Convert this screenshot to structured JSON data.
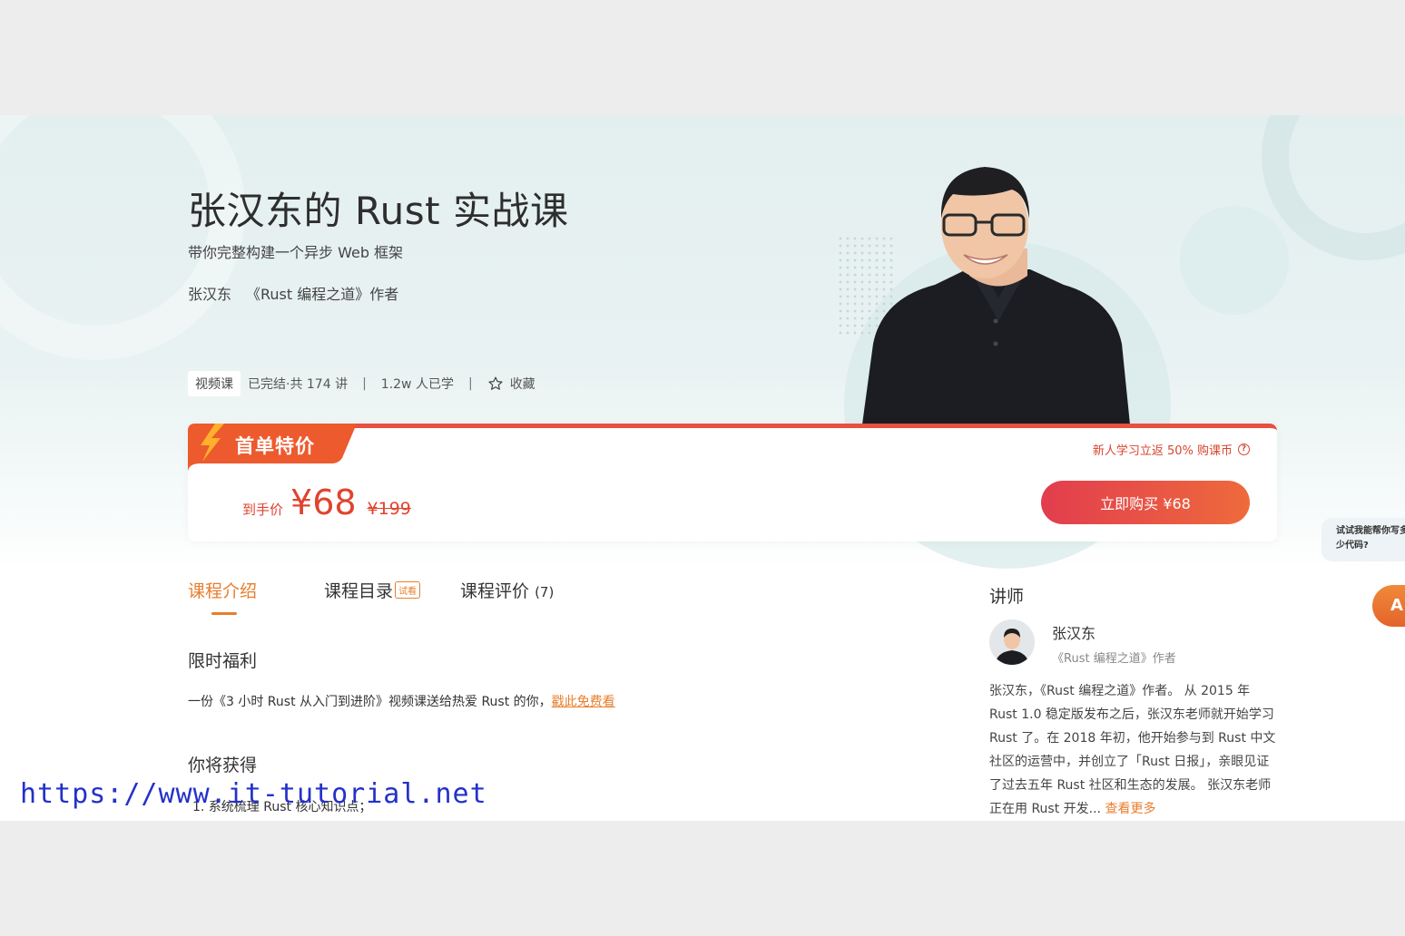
{
  "course": {
    "title": "张汉东的 Rust 实战课",
    "subtitle": "带你完整构建一个异步 Web 框架",
    "author_name": "张汉东",
    "author_title": "《Rust 编程之道》作者"
  },
  "meta": {
    "type_badge": "视频课",
    "status": "已完结·共 174 讲",
    "separator": "|",
    "learners": "1.2w 人已学",
    "favorite_label": "收藏"
  },
  "price": {
    "promo_tag": "首单特价",
    "promo_link": "新人学习立返 50% 购课币",
    "label": "到手价",
    "current": "¥68",
    "original": "¥199",
    "buy_button": "立即购买 ¥68"
  },
  "tabs": {
    "intro": "课程介绍",
    "catalog": "课程目录",
    "trial_badge": "试看",
    "review": "课程评价",
    "review_count": "(7)"
  },
  "content": {
    "benefit_title": "限时福利",
    "benefit_text": "一份《3 小时 Rust 从入门到进阶》视频课送给热爱 Rust 的你，",
    "benefit_link": "戳此免费看",
    "gain_title": "你将获得",
    "gain_item_1": "1. 系统梳理 Rust 核心知识点；"
  },
  "lecturer": {
    "heading": "讲师",
    "name": "张汉东",
    "role": "《Rust 编程之道》作者",
    "bio": "张汉东，《Rust 编程之道》作者。 从 2015 年 Rust 1.0 稳定版发布之后，张汉东老师就开始学习 Rust 了。在 2018 年初，他开始参与到 Rust 中文社区的运营中，并创立了「Rust 日报」，亲眼见证了过去五年 Rust 社区和生态的发展。 张汉东老师正在用 Rust 开发... ",
    "more": "查看更多"
  },
  "helper": {
    "bubble": "试试我能帮你写多少代码?",
    "button": "A"
  },
  "watermark": "https://www.it-tutorial.net",
  "colors": {
    "accent_orange": "#e87e2d",
    "price_red": "#e0432e",
    "buy_gradient_start": "#e23d4e",
    "buy_gradient_end": "#ee6a3c"
  }
}
